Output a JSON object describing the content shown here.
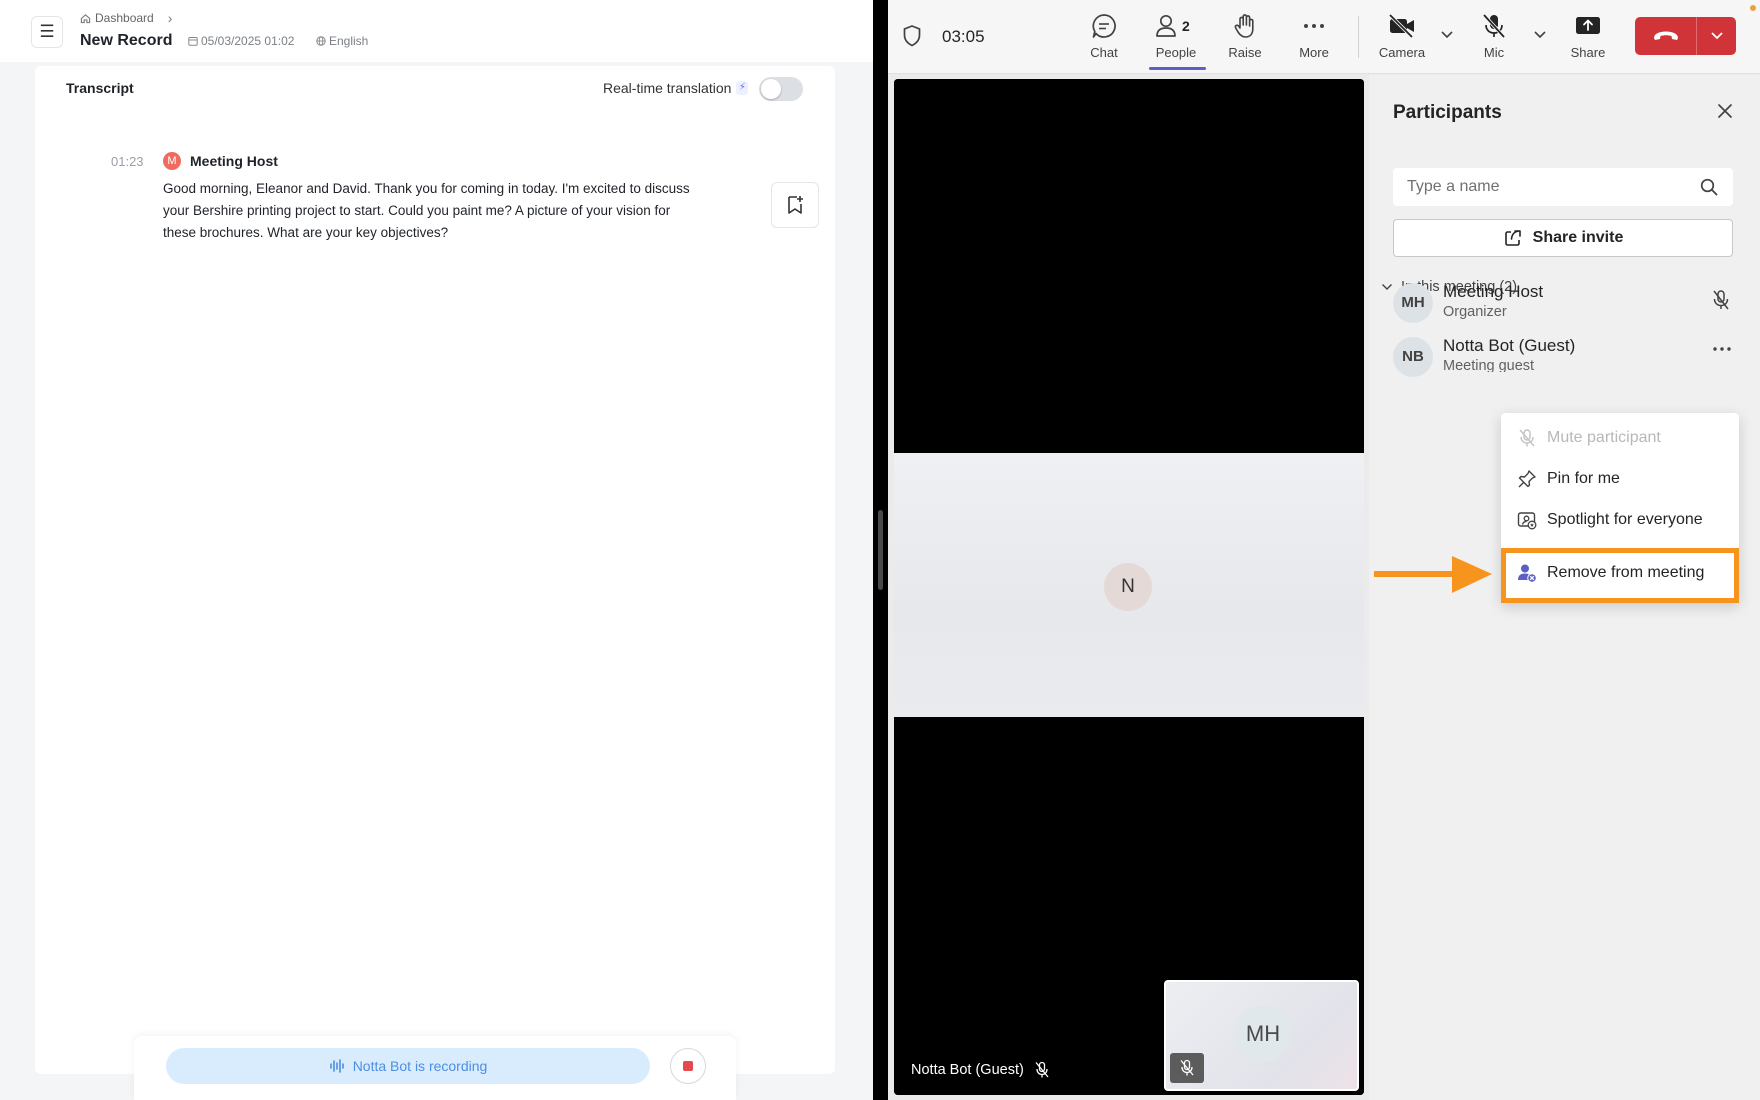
{
  "left": {
    "breadcrumb": "Dashboard",
    "record_title": "New Record",
    "date": "05/03/2025 01:02",
    "language": "English",
    "transcript_label": "Transcript",
    "translation_label": "Real-time translation",
    "translation_on": false,
    "segment": {
      "time": "01:23",
      "avatar_letter": "M",
      "speaker": "Meeting Host",
      "text": "Good morning, Eleanor and David. Thank you for coming in today. I'm excited to discuss your Bershire printing project to start. Could you paint me? A picture of your vision for these brochures. What are your key objectives?"
    },
    "recording_status": "Notta Bot is recording"
  },
  "teams": {
    "timer": "03:05",
    "toolbar": {
      "chat": "Chat",
      "people": "People",
      "people_count": "2",
      "raise": "Raise",
      "more": "More",
      "camera": "Camera",
      "mic": "Mic",
      "share": "Share"
    },
    "video": {
      "center_avatar": "N",
      "guest_label": "Notta Bot (Guest)",
      "self_avatar": "MH"
    },
    "panel": {
      "title": "Participants",
      "search_placeholder": "Type a name",
      "share_invite": "Share invite",
      "section": "In this meeting (2)",
      "participants": [
        {
          "initials": "MH",
          "name": "Meeting Host",
          "role": "Organizer"
        },
        {
          "initials": "NB",
          "name": "Notta Bot (Guest)",
          "role": "Meeting guest"
        }
      ]
    },
    "context_menu": {
      "items": [
        {
          "label": "Mute participant",
          "icon": "mic-off-icon",
          "enabled": false
        },
        {
          "label": "Pin for me",
          "icon": "pin-icon",
          "enabled": true
        },
        {
          "label": "Spotlight for everyone",
          "icon": "spotlight-icon",
          "enabled": true
        },
        {
          "label": "Remove from meeting",
          "icon": "remove-person-icon",
          "enabled": true,
          "highlighted": true
        }
      ]
    },
    "colors": {
      "accent": "#5b5fc7",
      "leave": "#d13438",
      "highlight": "#f7941d"
    }
  }
}
